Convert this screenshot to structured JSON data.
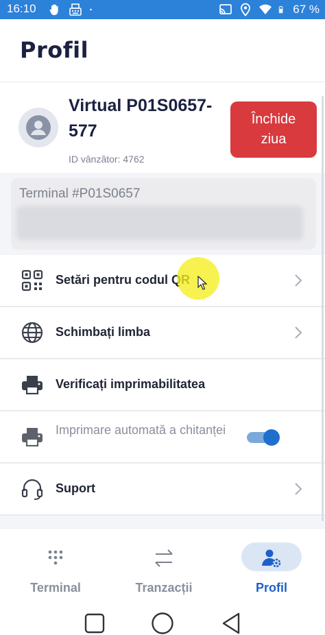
{
  "status_bar": {
    "time": "16:10",
    "battery": "67 %",
    "left_icons": [
      "hand-icon",
      "keyboard-icon",
      "dot-icon"
    ],
    "right_icons": [
      "cast-icon",
      "location-icon",
      "wifi-icon",
      "battery-icon"
    ]
  },
  "header": {
    "title": "Profil"
  },
  "profile": {
    "name": "Virtual P01S0657-577",
    "seller_id": "ID vânzător: 4762",
    "close_day_label": "Închide ziua"
  },
  "terminal": {
    "label": "Terminal #P01S0657"
  },
  "menu": {
    "items": [
      {
        "label": "Setări pentru codul QR",
        "icon": "qr-code-icon",
        "chevron": true
      },
      {
        "label": "Schimbați limba",
        "icon": "globe-icon",
        "chevron": true
      },
      {
        "label": "Verificați imprimabilitatea",
        "icon": "printer-icon",
        "chevron": false
      },
      {
        "label": "Imprimare automată a chitanței",
        "icon": "printer-icon",
        "toggle": true,
        "enabled": false
      },
      {
        "label": "Suport",
        "icon": "headset-icon",
        "chevron": true
      }
    ]
  },
  "bottom_nav": {
    "items": [
      {
        "label": "Terminal",
        "icon": "keypad-icon",
        "active": false
      },
      {
        "label": "Tranzacții",
        "icon": "transfer-arrows-icon",
        "active": false
      },
      {
        "label": "Profil",
        "icon": "user-settings-icon",
        "active": true
      }
    ]
  },
  "system_nav": [
    "recent-apps-icon",
    "home-icon",
    "back-icon"
  ],
  "colors": {
    "status_bar": "#2c81d9",
    "danger_button": "#d83a3e",
    "primary": "#1f5fc9",
    "toggle_knob": "#1f6fce",
    "tap_indicator": "#f5ee1e"
  }
}
